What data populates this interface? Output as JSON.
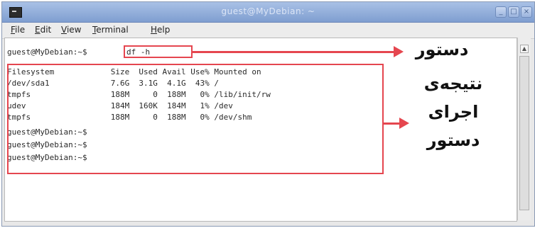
{
  "window": {
    "title": "guest@MyDebian: ~"
  },
  "menu": [
    "File",
    "Edit",
    "View",
    "Terminal",
    "Help"
  ],
  "terminal": {
    "prompt_line": "guest@MyDebian:~$",
    "command": "df -h",
    "header": "Filesystem            Size  Used Avail Use% Mounted on",
    "rows": [
      "/dev/sda1             7.6G  3.1G  4.1G  43% /",
      "tmpfs                 188M     0  188M   0% /lib/init/rw",
      "udev                  184M  160K  184M   1% /dev",
      "tmpfs                 188M     0  188M   0% /dev/shm"
    ],
    "trailing_prompts": [
      "guest@MyDebian:~$",
      "guest@MyDebian:~$",
      "guest@MyDebian:~$"
    ]
  },
  "annotations": {
    "command_label": "دستور",
    "result_label_lines": [
      "نتیجه‌ی",
      "اجرای",
      "دستور"
    ],
    "accent_color": "#e5464f"
  }
}
